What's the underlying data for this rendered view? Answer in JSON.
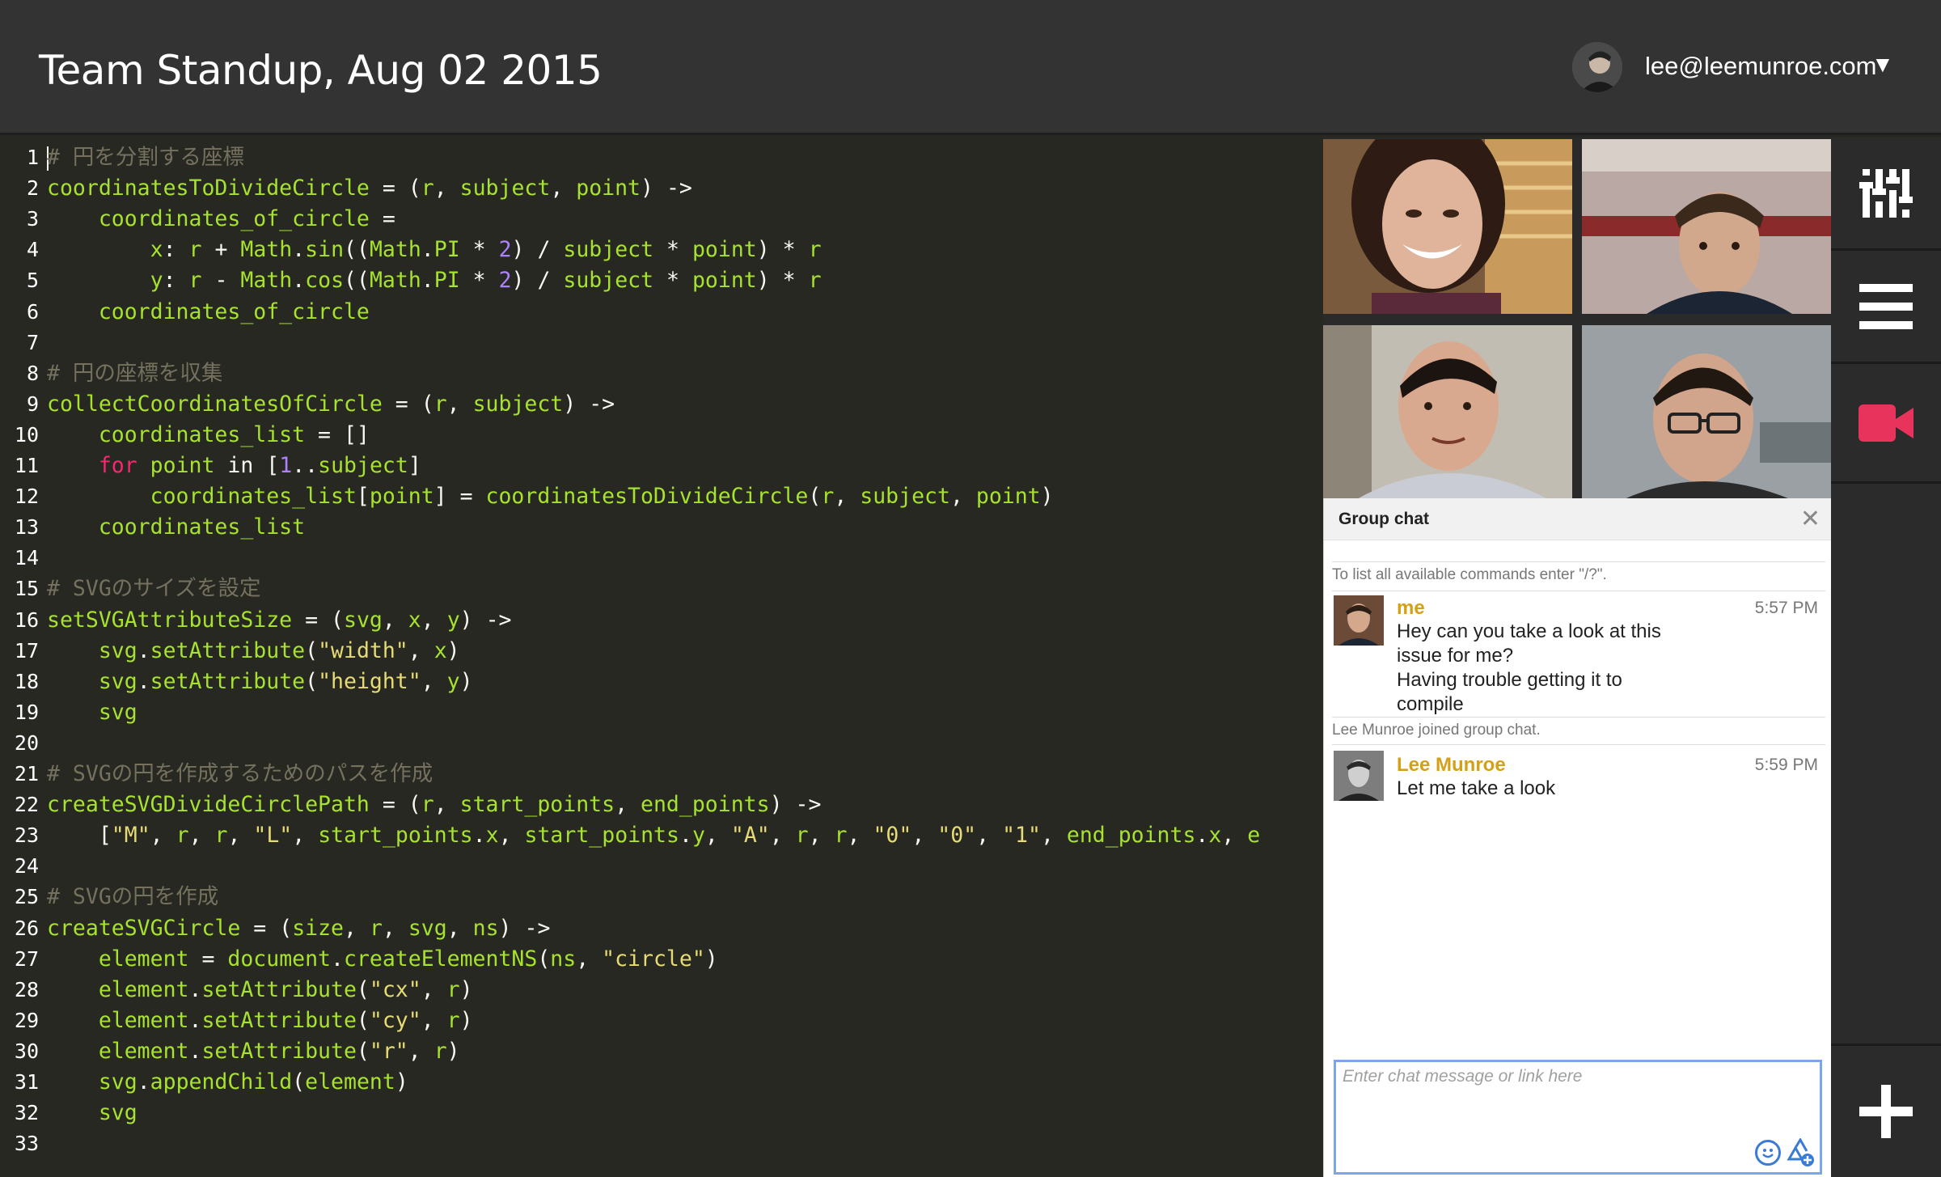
{
  "header": {
    "title": "Team Standup, Aug 02 2015",
    "user_email": "lee@leemunroe.com",
    "caret": "▼"
  },
  "editor": {
    "lines": [
      {
        "n": "1",
        "html": "<span class=\"cursor\"></span><span class=\"c-com\"># 円を分割する座標</span>"
      },
      {
        "n": "2",
        "html": "coordinatesToDivideCircle <span class=\"c-op\">=</span> <span class=\"c-op\">(</span>r<span class=\"c-op\">,</span> subject<span class=\"c-op\">,</span> point<span class=\"c-op\">)</span> <span class=\"c-op\">-&gt;</span>"
      },
      {
        "n": "3",
        "html": "    coordinates_of_circle <span class=\"c-op\">=</span>"
      },
      {
        "n": "4",
        "html": "        x<span class=\"c-op\">:</span> r <span class=\"c-op\">+</span> Math<span class=\"c-op\">.</span>sin<span class=\"c-op\">((</span>Math<span class=\"c-op\">.</span>PI <span class=\"c-op\">*</span> <span class=\"c-num\">2</span><span class=\"c-op\">)</span> <span class=\"c-op\">/</span> subject <span class=\"c-op\">*</span> point<span class=\"c-op\">)</span> <span class=\"c-op\">*</span> r"
      },
      {
        "n": "5",
        "html": "        y<span class=\"c-op\">:</span> r <span class=\"c-op\">-</span> Math<span class=\"c-op\">.</span>cos<span class=\"c-op\">((</span>Math<span class=\"c-op\">.</span>PI <span class=\"c-op\">*</span> <span class=\"c-num\">2</span><span class=\"c-op\">)</span> <span class=\"c-op\">/</span> subject <span class=\"c-op\">*</span> point<span class=\"c-op\">)</span> <span class=\"c-op\">*</span> r"
      },
      {
        "n": "6",
        "html": "    coordinates_of_circle"
      },
      {
        "n": "7",
        "html": ""
      },
      {
        "n": "8",
        "html": "<span class=\"c-com\"># 円の座標を収集</span>"
      },
      {
        "n": "9",
        "html": "collectCoordinatesOfCircle <span class=\"c-op\">=</span> <span class=\"c-op\">(</span>r<span class=\"c-op\">,</span> subject<span class=\"c-op\">)</span> <span class=\"c-op\">-&gt;</span>"
      },
      {
        "n": "10",
        "html": "    coordinates_list <span class=\"c-op\">=</span> <span class=\"c-op\">[]</span>"
      },
      {
        "n": "11",
        "html": "    <span class=\"c-kw\">for</span> point <span class=\"c-op\">in</span> <span class=\"c-op\">[</span><span class=\"c-num\">1</span><span class=\"c-op\">..</span>subject<span class=\"c-op\">]</span>"
      },
      {
        "n": "12",
        "html": "        coordinates_list<span class=\"c-op\">[</span>point<span class=\"c-op\">]</span> <span class=\"c-op\">=</span> coordinatesToDivideCircle<span class=\"c-op\">(</span>r<span class=\"c-op\">,</span> subject<span class=\"c-op\">,</span> point<span class=\"c-op\">)</span>"
      },
      {
        "n": "13",
        "html": "    coordinates_list"
      },
      {
        "n": "14",
        "html": ""
      },
      {
        "n": "15",
        "html": "<span class=\"c-com\"># SVGのサイズを設定</span>"
      },
      {
        "n": "16",
        "html": "setSVGAttributeSize <span class=\"c-op\">=</span> <span class=\"c-op\">(</span>svg<span class=\"c-op\">,</span> x<span class=\"c-op\">,</span> y<span class=\"c-op\">)</span> <span class=\"c-op\">-&gt;</span>"
      },
      {
        "n": "17",
        "html": "    svg<span class=\"c-op\">.</span>setAttribute<span class=\"c-op\">(</span><span class=\"c-str\">\"width\"</span><span class=\"c-op\">,</span> x<span class=\"c-op\">)</span>"
      },
      {
        "n": "18",
        "html": "    svg<span class=\"c-op\">.</span>setAttribute<span class=\"c-op\">(</span><span class=\"c-str\">\"height\"</span><span class=\"c-op\">,</span> y<span class=\"c-op\">)</span>"
      },
      {
        "n": "19",
        "html": "    svg"
      },
      {
        "n": "20",
        "html": ""
      },
      {
        "n": "21",
        "html": "<span class=\"c-com\"># SVGの円を作成するためのパスを作成</span>"
      },
      {
        "n": "22",
        "html": "createSVGDivideCirclePath <span class=\"c-op\">=</span> <span class=\"c-op\">(</span>r<span class=\"c-op\">,</span> start_points<span class=\"c-op\">,</span> end_points<span class=\"c-op\">)</span> <span class=\"c-op\">-&gt;</span>"
      },
      {
        "n": "23",
        "html": "    <span class=\"c-op\">[</span><span class=\"c-str\">\"M\"</span><span class=\"c-op\">,</span> r<span class=\"c-op\">,</span> r<span class=\"c-op\">,</span> <span class=\"c-str\">\"L\"</span><span class=\"c-op\">,</span> start_points<span class=\"c-op\">.</span>x<span class=\"c-op\">,</span> start_points<span class=\"c-op\">.</span>y<span class=\"c-op\">,</span> <span class=\"c-str\">\"A\"</span><span class=\"c-op\">,</span> r<span class=\"c-op\">,</span> r<span class=\"c-op\">,</span> <span class=\"c-str\">\"0\"</span><span class=\"c-op\">,</span> <span class=\"c-str\">\"0\"</span><span class=\"c-op\">,</span> <span class=\"c-str\">\"1\"</span><span class=\"c-op\">,</span> end_points<span class=\"c-op\">.</span>x<span class=\"c-op\">,</span> e"
      },
      {
        "n": "24",
        "html": ""
      },
      {
        "n": "25",
        "html": "<span class=\"c-com\"># SVGの円を作成</span>"
      },
      {
        "n": "26",
        "html": "createSVGCircle <span class=\"c-op\">=</span> <span class=\"c-op\">(</span>size<span class=\"c-op\">,</span> r<span class=\"c-op\">,</span> svg<span class=\"c-op\">,</span> ns<span class=\"c-op\">)</span> <span class=\"c-op\">-&gt;</span>"
      },
      {
        "n": "27",
        "html": "    element <span class=\"c-op\">=</span> document<span class=\"c-op\">.</span>createElementNS<span class=\"c-op\">(</span>ns<span class=\"c-op\">,</span> <span class=\"c-str\">\"circle\"</span><span class=\"c-op\">)</span>"
      },
      {
        "n": "28",
        "html": "    element<span class=\"c-op\">.</span>setAttribute<span class=\"c-op\">(</span><span class=\"c-str\">\"cx\"</span><span class=\"c-op\">,</span> r<span class=\"c-op\">)</span>"
      },
      {
        "n": "29",
        "html": "    element<span class=\"c-op\">.</span>setAttribute<span class=\"c-op\">(</span><span class=\"c-str\">\"cy\"</span><span class=\"c-op\">,</span> r<span class=\"c-op\">)</span>"
      },
      {
        "n": "30",
        "html": "    element<span class=\"c-op\">.</span>setAttribute<span class=\"c-op\">(</span><span class=\"c-str\">\"r\"</span><span class=\"c-op\">,</span> r<span class=\"c-op\">)</span>"
      },
      {
        "n": "31",
        "html": "    svg<span class=\"c-op\">.</span>appendChild<span class=\"c-op\">(</span>element<span class=\"c-op\">)</span>"
      },
      {
        "n": "32",
        "html": "    svg"
      },
      {
        "n": "33",
        "html": ""
      }
    ]
  },
  "chat": {
    "title": "Group chat",
    "close": "✕",
    "system_hint": "To list all available commands enter \"/?\".",
    "joined_notice": "Lee Munroe joined group chat.",
    "messages": [
      {
        "name": "me",
        "time": "5:57 PM",
        "text": "Hey can you take a look at this issue for me?\nHaving trouble getting it to compile"
      },
      {
        "name": "Lee Munroe",
        "time": "5:59 PM",
        "text": "Let me take a look"
      }
    ],
    "input_placeholder": "Enter chat message or link here"
  },
  "rail": {
    "icons": [
      "sliders-icon",
      "menu-icon",
      "video-icon",
      "add-icon"
    ],
    "active_color": "#e8345d"
  },
  "colors": {
    "accent_gold": "#d4a017",
    "input_border": "#7aa7e9"
  }
}
